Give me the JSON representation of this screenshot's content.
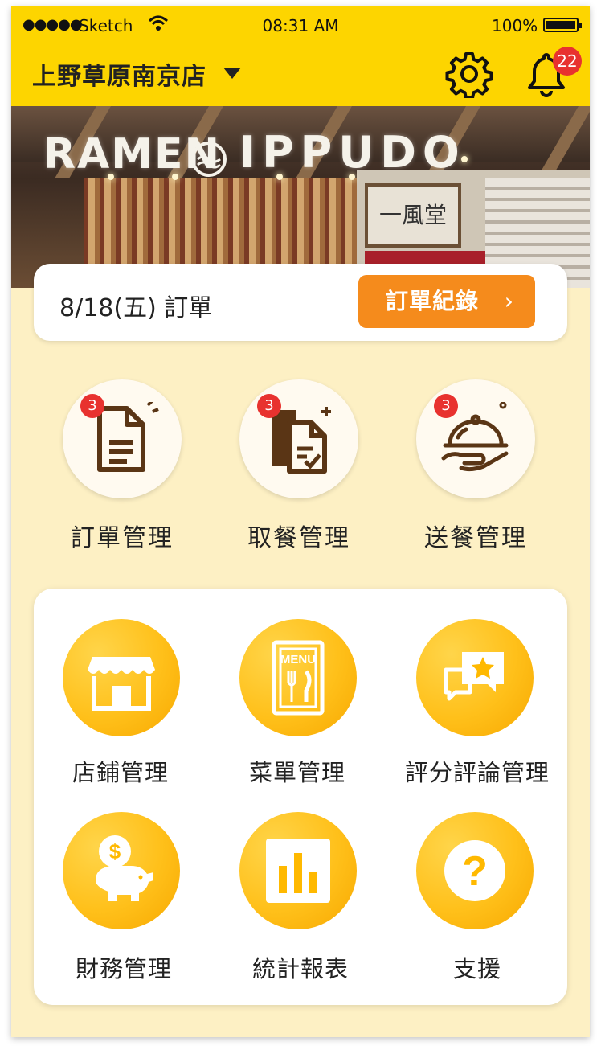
{
  "status_bar": {
    "dots": "●●●●●",
    "carrier": "Sketch",
    "time": "08:31 AM",
    "battery": "100%"
  },
  "header": {
    "store_name": "上野草原南京店",
    "notification_count": "22"
  },
  "banner": {
    "sign_left": "RAMEN",
    "sign_right": "IPPUDO",
    "sign_small": "一風堂"
  },
  "orders": {
    "title": "8/18(五) 訂單",
    "button_label": "訂單紀錄",
    "button_chevron": "›"
  },
  "quick_actions": [
    {
      "label": "訂單管理",
      "badge": "3",
      "icon": "document-icon"
    },
    {
      "label": "取餐管理",
      "badge": "3",
      "icon": "pickup-documents-icon"
    },
    {
      "label": "送餐管理",
      "badge": "3",
      "icon": "cloche-delivery-icon"
    }
  ],
  "menu_grid": [
    {
      "label": "店鋪管理",
      "icon": "storefront-icon"
    },
    {
      "label": "菜單管理",
      "icon": "menu-card-icon",
      "icon_text": "MENU"
    },
    {
      "label": "評分評論管理",
      "icon": "review-star-icon"
    },
    {
      "label": "財務管理",
      "icon": "piggy-bank-icon",
      "icon_text": "$"
    },
    {
      "label": "統計報表",
      "icon": "bar-chart-icon"
    },
    {
      "label": "支援",
      "icon": "help-icon",
      "icon_text": "?"
    }
  ],
  "colors": {
    "header_yellow": "#fdd500",
    "background_cream": "#fdf0c4",
    "accent_orange": "#f58b1c",
    "badge_red": "#e8322f",
    "icon_gold": "#ffc01a",
    "icon_brown": "#5a3515"
  }
}
